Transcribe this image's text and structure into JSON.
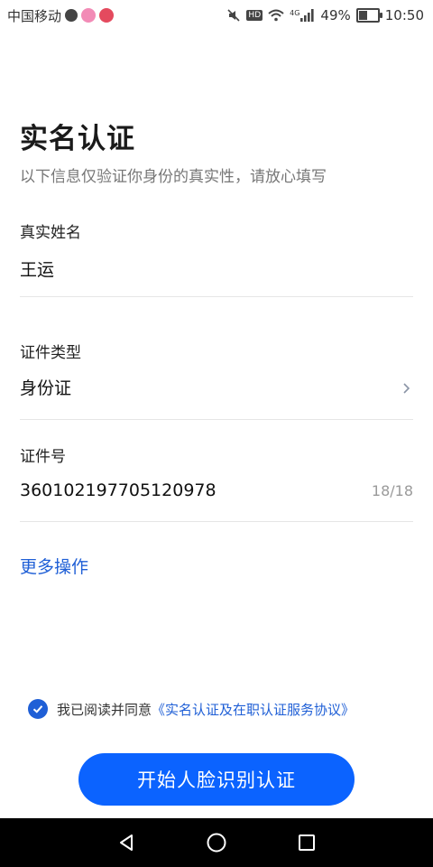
{
  "status_bar": {
    "carrier": "中国移动",
    "hd": "HD",
    "network": "4G",
    "battery_text": "49%",
    "battery_level": 0.49,
    "time": "10:50"
  },
  "header": {
    "title": "实名认证",
    "subtitle": "以下信息仅验证你身份的真实性，请放心填写"
  },
  "fields": {
    "name": {
      "label": "真实姓名",
      "value": "王运"
    },
    "id_type": {
      "label": "证件类型",
      "value": "身份证"
    },
    "id_number": {
      "label": "证件号",
      "value": "360102197705120978",
      "counter": "18/18"
    }
  },
  "more_ops": "更多操作",
  "agreement": {
    "checked": true,
    "text": "我已阅读并同意",
    "link": "《实名认证及在职认证服务协议》"
  },
  "start_button": "开始人脸识别认证",
  "colors": {
    "accent": "#1f5fd6",
    "button": "#0b63ff",
    "nav_bg": "#000000"
  },
  "icons": {
    "back": "back-triangle-icon",
    "home": "home-circle-icon",
    "recent": "recent-square-icon",
    "chevron": "chevron-right-icon",
    "check": "check-icon"
  }
}
